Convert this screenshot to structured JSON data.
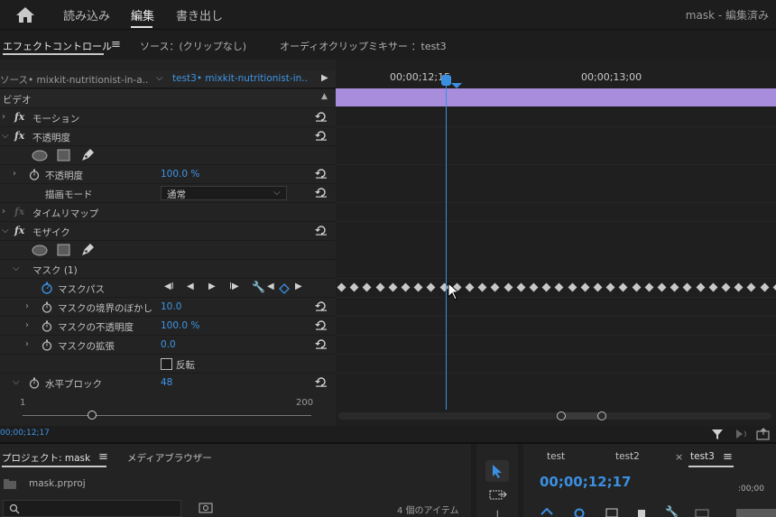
{
  "topbar": {
    "workspaces": [
      "読み込み",
      "編集",
      "書き出し"
    ],
    "active_workspace": "編集",
    "status": "mask - 編集済み"
  },
  "panel_tabs": {
    "effect_controls": "エフェクトコントロール",
    "source": "ソース：(クリップなし)",
    "audio_mixer": "オーディオクリップミキサー ：test3"
  },
  "clip_selector": {
    "source_clip": "ソース• mixkit-nutritionist-in-a...",
    "sequence_clip": "test3• mixkit-nutritionist-in..."
  },
  "timeline_ruler": {
    "t1": "00;00;12;15",
    "t2": "00;00;13;00"
  },
  "sections": {
    "video": "ビデオ",
    "motion": "モーション",
    "opacity": "不透明度",
    "opacity_prop": "不透明度",
    "opacity_value": "100.0 %",
    "blend_mode_label": "描画モード",
    "blend_mode_value": "通常",
    "time_remap": "タイムリマップ",
    "mosaic": "モザイク",
    "mask": "マスク (1)",
    "mask_path": "マスクパス",
    "mask_feather": "マスクの境界のぼかし",
    "mask_feather_value": "10.0",
    "mask_opacity": "マスクの不透明度",
    "mask_opacity_value": "100.0 %",
    "mask_expansion": "マスクの拡張",
    "mask_expansion_value": "0.0",
    "inverted": "反転",
    "h_blocks": "水平ブロック",
    "h_blocks_value": "48",
    "slider_min": "1",
    "slider_max": "200"
  },
  "slider_level": 0.24,
  "ec_timecode": "00;00;12;17",
  "project": {
    "tab": "プロジェクト: mask",
    "media_browser": "メディアブラウザー",
    "file": "mask.prproj",
    "count": "4 個のアイテム"
  },
  "sequence": {
    "tabs": [
      "test",
      "test2",
      "test3"
    ],
    "timecode": "00;00;12;17",
    "ruler": ":00;00"
  },
  "colors": {
    "accent": "#3b8fe0",
    "clip": "#a78ddc",
    "value": "#3e95e6"
  }
}
